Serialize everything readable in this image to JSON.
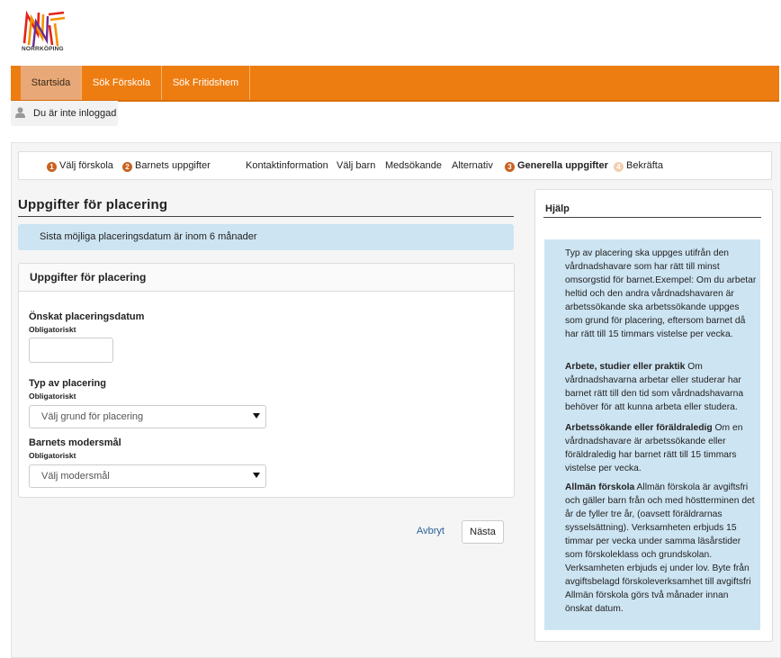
{
  "brand": {
    "name": "NORRKÖPING",
    "colors": [
      "#e2231a",
      "#f39200",
      "#6b2c91"
    ]
  },
  "nav": {
    "items": [
      {
        "label": "Startsida",
        "active": true
      },
      {
        "label": "Sök Förskola"
      },
      {
        "label": "Sök Fritidshem"
      }
    ],
    "accent": "#ee7d11"
  },
  "login": {
    "icon": "user-icon",
    "text": "Du är inte inloggad"
  },
  "steps": [
    {
      "num": "1",
      "label": "Välj förskola"
    },
    {
      "num": "2",
      "label": "Barnets uppgifter"
    },
    {
      "label": "Kontaktinformation"
    },
    {
      "label": "Välj barn"
    },
    {
      "label": "Medsökande"
    },
    {
      "label": "Alternativ"
    },
    {
      "num": "3",
      "label": "Generella uppgifter",
      "current": true
    },
    {
      "num": "4",
      "label": "Bekräfta"
    }
  ],
  "main": {
    "title": "Uppgifter för placering",
    "info": "Sista möjliga placeringsdatum är inom 6 månader",
    "panel_title": "Uppgifter för placering",
    "fields": {
      "date": {
        "label": "Önskat placeringsdatum",
        "required": "Obligatoriskt",
        "value": ""
      },
      "type": {
        "label": "Typ av placering",
        "required": "Obligatoriskt",
        "placeholder": "Välj grund för placering"
      },
      "language": {
        "label": "Barnets modersmål",
        "required": "Obligatoriskt",
        "placeholder": "Välj modersmål"
      }
    },
    "cancel": "Avbryt",
    "next": "Nästa"
  },
  "help": {
    "title": "Hjälp",
    "intro": "Typ av placering ska uppges utifrån den vårdnadshavare som har rätt till minst omsorgstid för barnet.Exempel: Om du arbetar heltid och den andra vårdnadshavaren är arbetssökande ska arbetssökande uppges som grund för placering, eftersom barnet då har rätt till 15 timmars vistelse per vecka.",
    "items": [
      {
        "term": "Arbete, studier eller praktik",
        "text": "Om vårdnadshavarna arbetar eller studerar har barnet rätt till den tid som vårdnadshavarna behöver för att kunna arbeta eller studera."
      },
      {
        "term": "Arbetssökande eller föräldraledig",
        "text": "Om en vårdnadshavare är arbetssökande eller föräldraledig har barnet rätt till 15 timmars vistelse per vecka."
      },
      {
        "term": "Allmän förskola",
        "text": "Allmän förskola är avgiftsfri och gäller barn från och med höstterminen det år de fyller tre år, (oavsett föräldrarnas sysselsättning). Verksamheten erbjuds 15 timmar per vecka under samma läsårstider som förskoleklass och grundskolan. Verksamheten erbjuds ej under lov. Byte från avgiftsbelagd förskoleverksamhet till avgiftsfri Allmän förskola görs två månader innan önskat datum."
      }
    ]
  }
}
